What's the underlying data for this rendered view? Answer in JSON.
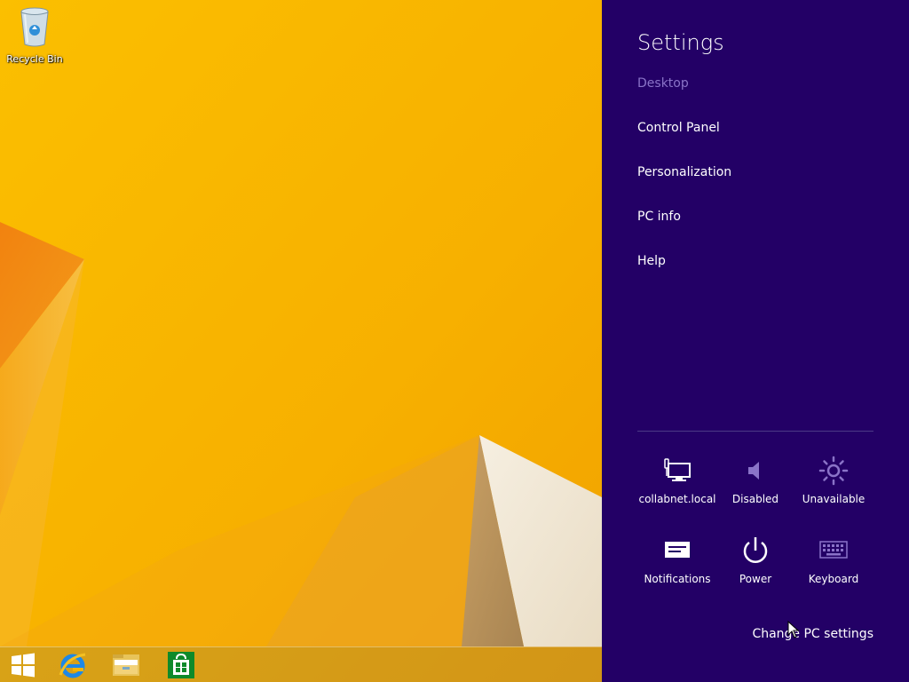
{
  "desktop": {
    "recycle_bin_label": "Recycle Bin",
    "wallpaper_colors": {
      "base": "#f6b300",
      "orange": "#f07a10",
      "cream": "#f3ead8"
    }
  },
  "taskbar": {
    "items": [
      "start-button",
      "internet-explorer",
      "file-explorer",
      "store"
    ]
  },
  "charm": {
    "background": "#230066",
    "title": "Settings",
    "context": "Desktop",
    "links": [
      "Control Panel",
      "Personalization",
      "PC info",
      "Help"
    ],
    "quick_tiles": [
      {
        "label": "collabnet.local",
        "icon": "network-icon"
      },
      {
        "label": "Disabled",
        "icon": "volume-icon"
      },
      {
        "label": "Unavailable",
        "icon": "brightness-icon"
      },
      {
        "label": "Notifications",
        "icon": "notifications-icon"
      },
      {
        "label": "Power",
        "icon": "power-icon"
      },
      {
        "label": "Keyboard",
        "icon": "keyboard-icon"
      }
    ],
    "change_pc_settings": "Change PC settings"
  }
}
